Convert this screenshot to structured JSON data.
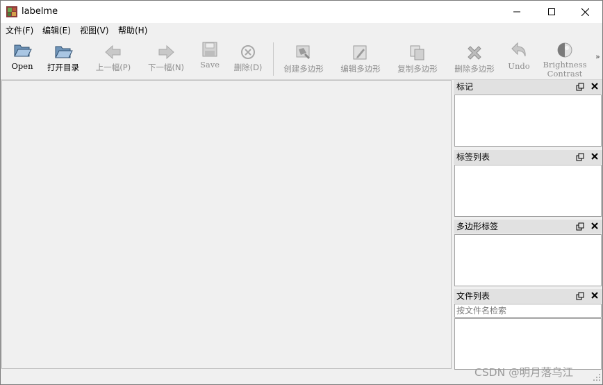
{
  "window": {
    "title": "labelme"
  },
  "menu": {
    "items": [
      "文件(F)",
      "编辑(E)",
      "视图(V)",
      "帮助(H)"
    ]
  },
  "toolbar": {
    "open": "Open",
    "open_dir": "打开目录",
    "prev": "上一幅(P)",
    "next": "下一幅(N)",
    "save": "Save",
    "delete_file": "删除(D)",
    "create_polygon": "创建多边形",
    "edit_polygon": "编辑多边形",
    "copy_polygon": "复制多边形",
    "delete_polygon": "删除多边形",
    "undo": "Undo",
    "brightness_line1": "Brightness",
    "brightness_line2": "Contrast",
    "extension": "»"
  },
  "docks": {
    "flags": {
      "title": "标记"
    },
    "labels": {
      "title": "标签列表"
    },
    "polygons": {
      "title": "多边形标签"
    },
    "files": {
      "title": "文件列表",
      "search_placeholder": "按文件名检索"
    }
  },
  "watermark": "CSDN @明月落乌江",
  "colors": {
    "window_bg": "#f0f0f0",
    "panel_header": "#e1e1e1",
    "disabled_text": "#8d8d8d"
  }
}
